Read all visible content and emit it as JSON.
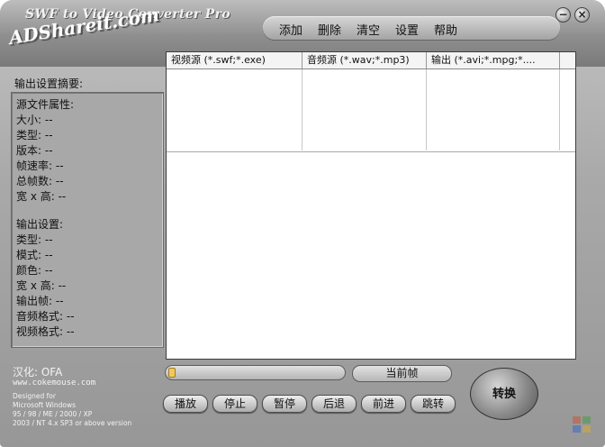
{
  "window": {
    "title": "SWF to Video Converter Pro",
    "brand": "ADShareit.com"
  },
  "menu": {
    "items": [
      "添加",
      "删除",
      "清空",
      "设置",
      "帮助"
    ]
  },
  "summary": {
    "header": "输出设置摘要:",
    "source": {
      "heading": "源文件属性:",
      "rows": [
        "大小: --",
        "类型: --",
        "版本: --",
        "帧速率: --",
        "总帧数: --",
        "宽 x 高: --"
      ]
    },
    "output": {
      "heading": "输出设置:",
      "rows": [
        "类型: --",
        "模式: --",
        "颜色: --",
        "宽 x 高: --",
        "输出帧: --",
        "音频格式: --",
        "视频格式: --"
      ]
    }
  },
  "credits": {
    "localized": "汉化: OFA",
    "site": "www.cokemouse.com",
    "designed": [
      "Designed for",
      "Microsoft Windows",
      "95 / 98 / ME / 2000 / XP",
      "2003 / NT 4.x SP3 or above version"
    ]
  },
  "file_list": {
    "columns": [
      "视频源 (*.swf;*.exe)",
      "音频源 (*.wav;*.mp3)",
      "输出 (*.avi;*.mpg;*...."
    ],
    "rows": []
  },
  "progress": {
    "value": 0
  },
  "frame_label": "当前帧",
  "controls": [
    "播放",
    "停止",
    "暂停",
    "后退",
    "前进",
    "跳转"
  ],
  "convert_label": "转换",
  "colors": {
    "window_gray": "#a9a9a9",
    "progress_fill": "#efc95e",
    "list_bg": "#ffffff"
  }
}
